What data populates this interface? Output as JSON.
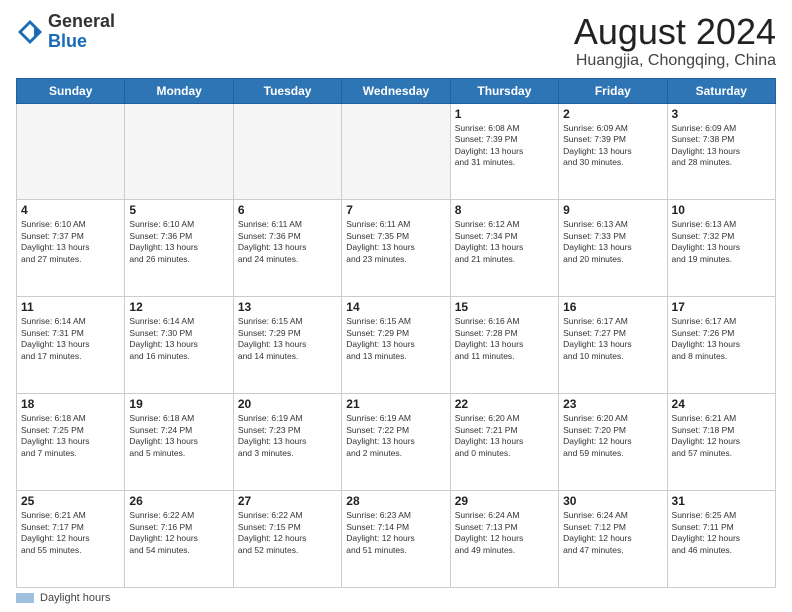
{
  "logo": {
    "general": "General",
    "blue": "Blue"
  },
  "header": {
    "month_year": "August 2024",
    "location": "Huangjia, Chongqing, China"
  },
  "weekdays": [
    "Sunday",
    "Monday",
    "Tuesday",
    "Wednesday",
    "Thursday",
    "Friday",
    "Saturday"
  ],
  "weeks": [
    [
      {
        "day": "",
        "info": ""
      },
      {
        "day": "",
        "info": ""
      },
      {
        "day": "",
        "info": ""
      },
      {
        "day": "",
        "info": ""
      },
      {
        "day": "1",
        "info": "Sunrise: 6:08 AM\nSunset: 7:39 PM\nDaylight: 13 hours\nand 31 minutes."
      },
      {
        "day": "2",
        "info": "Sunrise: 6:09 AM\nSunset: 7:39 PM\nDaylight: 13 hours\nand 30 minutes."
      },
      {
        "day": "3",
        "info": "Sunrise: 6:09 AM\nSunset: 7:38 PM\nDaylight: 13 hours\nand 28 minutes."
      }
    ],
    [
      {
        "day": "4",
        "info": "Sunrise: 6:10 AM\nSunset: 7:37 PM\nDaylight: 13 hours\nand 27 minutes."
      },
      {
        "day": "5",
        "info": "Sunrise: 6:10 AM\nSunset: 7:36 PM\nDaylight: 13 hours\nand 26 minutes."
      },
      {
        "day": "6",
        "info": "Sunrise: 6:11 AM\nSunset: 7:36 PM\nDaylight: 13 hours\nand 24 minutes."
      },
      {
        "day": "7",
        "info": "Sunrise: 6:11 AM\nSunset: 7:35 PM\nDaylight: 13 hours\nand 23 minutes."
      },
      {
        "day": "8",
        "info": "Sunrise: 6:12 AM\nSunset: 7:34 PM\nDaylight: 13 hours\nand 21 minutes."
      },
      {
        "day": "9",
        "info": "Sunrise: 6:13 AM\nSunset: 7:33 PM\nDaylight: 13 hours\nand 20 minutes."
      },
      {
        "day": "10",
        "info": "Sunrise: 6:13 AM\nSunset: 7:32 PM\nDaylight: 13 hours\nand 19 minutes."
      }
    ],
    [
      {
        "day": "11",
        "info": "Sunrise: 6:14 AM\nSunset: 7:31 PM\nDaylight: 13 hours\nand 17 minutes."
      },
      {
        "day": "12",
        "info": "Sunrise: 6:14 AM\nSunset: 7:30 PM\nDaylight: 13 hours\nand 16 minutes."
      },
      {
        "day": "13",
        "info": "Sunrise: 6:15 AM\nSunset: 7:29 PM\nDaylight: 13 hours\nand 14 minutes."
      },
      {
        "day": "14",
        "info": "Sunrise: 6:15 AM\nSunset: 7:29 PM\nDaylight: 13 hours\nand 13 minutes."
      },
      {
        "day": "15",
        "info": "Sunrise: 6:16 AM\nSunset: 7:28 PM\nDaylight: 13 hours\nand 11 minutes."
      },
      {
        "day": "16",
        "info": "Sunrise: 6:17 AM\nSunset: 7:27 PM\nDaylight: 13 hours\nand 10 minutes."
      },
      {
        "day": "17",
        "info": "Sunrise: 6:17 AM\nSunset: 7:26 PM\nDaylight: 13 hours\nand 8 minutes."
      }
    ],
    [
      {
        "day": "18",
        "info": "Sunrise: 6:18 AM\nSunset: 7:25 PM\nDaylight: 13 hours\nand 7 minutes."
      },
      {
        "day": "19",
        "info": "Sunrise: 6:18 AM\nSunset: 7:24 PM\nDaylight: 13 hours\nand 5 minutes."
      },
      {
        "day": "20",
        "info": "Sunrise: 6:19 AM\nSunset: 7:23 PM\nDaylight: 13 hours\nand 3 minutes."
      },
      {
        "day": "21",
        "info": "Sunrise: 6:19 AM\nSunset: 7:22 PM\nDaylight: 13 hours\nand 2 minutes."
      },
      {
        "day": "22",
        "info": "Sunrise: 6:20 AM\nSunset: 7:21 PM\nDaylight: 13 hours\nand 0 minutes."
      },
      {
        "day": "23",
        "info": "Sunrise: 6:20 AM\nSunset: 7:20 PM\nDaylight: 12 hours\nand 59 minutes."
      },
      {
        "day": "24",
        "info": "Sunrise: 6:21 AM\nSunset: 7:18 PM\nDaylight: 12 hours\nand 57 minutes."
      }
    ],
    [
      {
        "day": "25",
        "info": "Sunrise: 6:21 AM\nSunset: 7:17 PM\nDaylight: 12 hours\nand 55 minutes."
      },
      {
        "day": "26",
        "info": "Sunrise: 6:22 AM\nSunset: 7:16 PM\nDaylight: 12 hours\nand 54 minutes."
      },
      {
        "day": "27",
        "info": "Sunrise: 6:22 AM\nSunset: 7:15 PM\nDaylight: 12 hours\nand 52 minutes."
      },
      {
        "day": "28",
        "info": "Sunrise: 6:23 AM\nSunset: 7:14 PM\nDaylight: 12 hours\nand 51 minutes."
      },
      {
        "day": "29",
        "info": "Sunrise: 6:24 AM\nSunset: 7:13 PM\nDaylight: 12 hours\nand 49 minutes."
      },
      {
        "day": "30",
        "info": "Sunrise: 6:24 AM\nSunset: 7:12 PM\nDaylight: 12 hours\nand 47 minutes."
      },
      {
        "day": "31",
        "info": "Sunrise: 6:25 AM\nSunset: 7:11 PM\nDaylight: 12 hours\nand 46 minutes."
      }
    ]
  ],
  "footer": {
    "swatch_label": "Daylight hours"
  }
}
